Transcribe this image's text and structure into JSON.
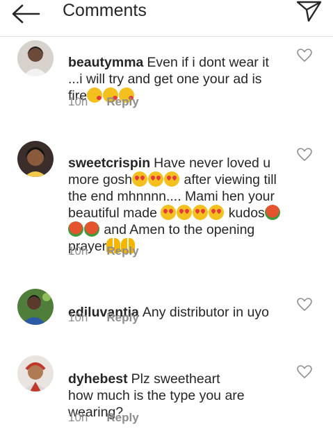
{
  "header": {
    "title": "Comments",
    "back_icon": "arrow-left-icon",
    "send_icon": "send-icon"
  },
  "colors": {
    "text": "#262626",
    "muted": "#8e8e8e",
    "divider": "#dcdcdc"
  },
  "comments": [
    {
      "username": "beautymma",
      "text": "Even if i dont wear it ...i will try and get one your ad is fire",
      "emoji_trailing": "😘😘😘",
      "time": "10h",
      "reply": "Reply"
    },
    {
      "username": "sweetcrispin",
      "text_parts": [
        "Have never loved u more gosh",
        "😍😍😍",
        " after viewing till the end mhnnnn.... Mami hen your beautiful made ",
        "😍😍😍😍",
        " kudos",
        "🌹🌹🌹",
        " and Amen to the opening prayer",
        "🙏🙏"
      ],
      "time": "10h",
      "reply": "Reply"
    },
    {
      "username": "ediluvantia",
      "text": "Any distributor in uyo",
      "time": "10h",
      "reply": "Reply"
    },
    {
      "username": "dyhebest",
      "text": "Plz sweetheart\nhow much is the type you are wearing?",
      "time": "10h",
      "reply": "Reply"
    }
  ]
}
